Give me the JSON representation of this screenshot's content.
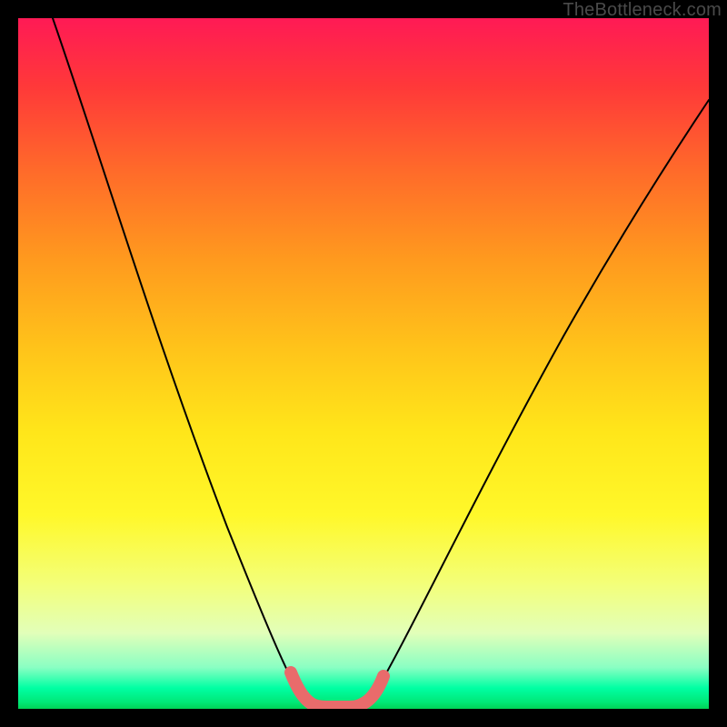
{
  "watermark": "TheBottleneck.com",
  "chart_data": {
    "type": "line",
    "title": "",
    "xlabel": "",
    "ylabel": "",
    "xlim": [
      0,
      100
    ],
    "ylim": [
      0,
      100
    ],
    "series": [
      {
        "name": "bottleneck-curve",
        "x": [
          5,
          10,
          15,
          20,
          25,
          30,
          35,
          38,
          40,
          42,
          44,
          46,
          48,
          50,
          55,
          60,
          65,
          70,
          75,
          80,
          85,
          90,
          95,
          100
        ],
        "y": [
          100,
          87,
          74,
          61,
          48,
          35,
          22,
          12,
          6,
          2,
          0,
          0,
          0,
          2,
          8,
          16,
          24,
          32,
          40,
          48,
          55,
          62,
          68,
          73
        ]
      },
      {
        "name": "optimal-range-marker",
        "x": [
          40,
          42,
          44,
          46,
          48,
          50
        ],
        "y": [
          6,
          2,
          0,
          0,
          0,
          2
        ]
      }
    ],
    "colors": {
      "curve": "#000000",
      "marker": "#e96b6b",
      "gradient_top": "#ff1a55",
      "gradient_bottom": "#00d256"
    }
  }
}
